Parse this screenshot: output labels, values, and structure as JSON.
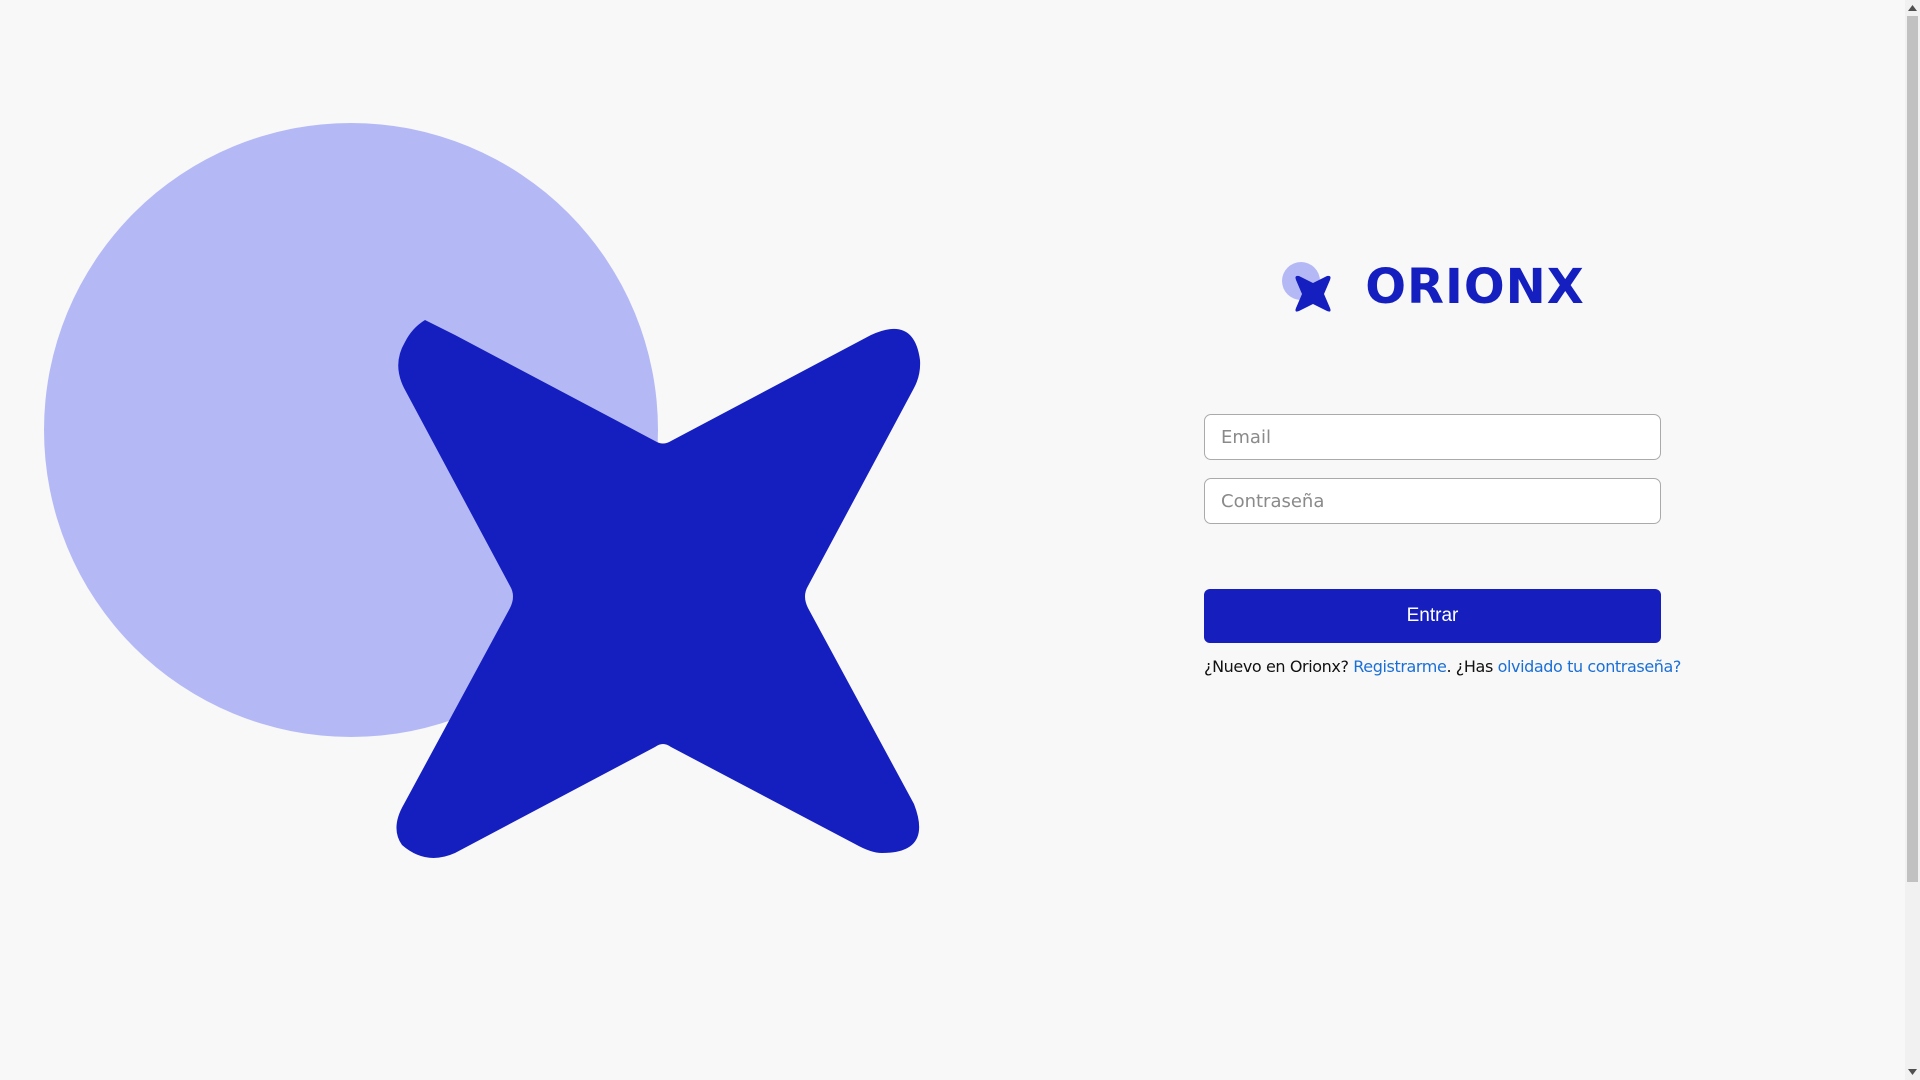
{
  "brand": {
    "name": "ORIONX",
    "primary_color": "#151fbf",
    "circle_color": "#b4b9f6"
  },
  "hero": {
    "icon": "orionx-star-circle-illustration"
  },
  "login": {
    "email_placeholder": "Email",
    "password_placeholder": "Contraseña",
    "submit_label": "Entrar"
  },
  "footer": {
    "new_prefix": "¿Nuevo en Orionx?",
    "register_link": "Registrarme",
    "separator": ". ¿Has",
    "forgot_link": "olvidado tu contraseña?"
  }
}
